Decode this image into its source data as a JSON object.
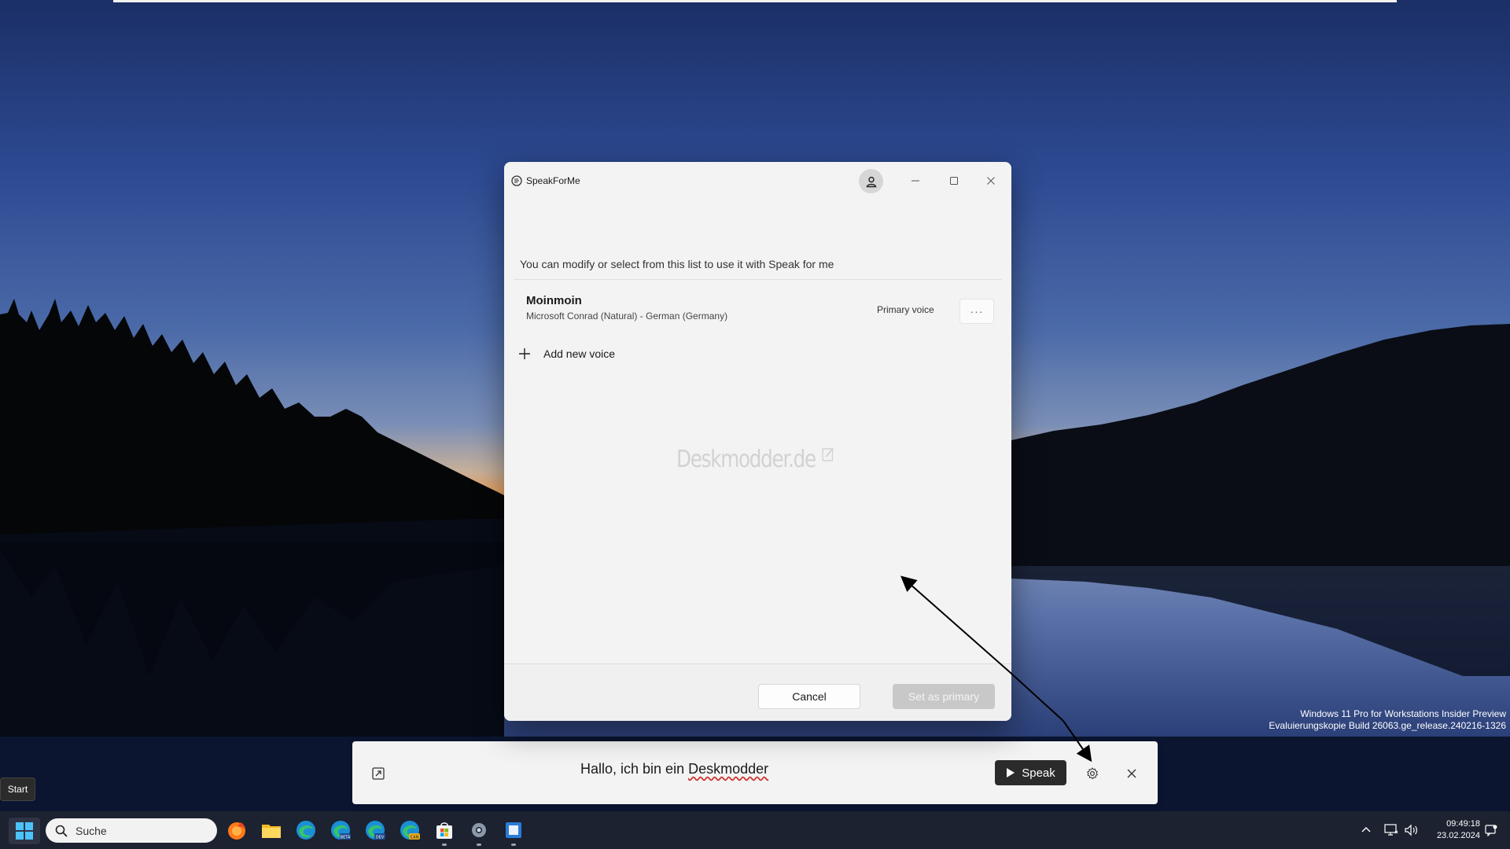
{
  "desktop": {
    "edition_line1": "Windows 11 Pro for Workstations Insider Preview",
    "edition_line2": "Evaluierungskopie Build 26063.ge_release.240216-1326"
  },
  "window": {
    "app_title": "SpeakForMe",
    "intro_text": "You can modify or select from this list to use it with Speak for me",
    "voices": [
      {
        "name": "Moinmoin",
        "description": "Microsoft Conrad (Natural) - German (Germany)",
        "status": "Primary voice",
        "more_label": "···"
      }
    ],
    "add_voice_label": "Add new voice",
    "site_mark": "Deskmodder.de",
    "cancel_label": "Cancel",
    "set_primary_label": "Set as primary"
  },
  "speakbar": {
    "phrase_part1": "Hallo, ich bin ein ",
    "phrase_part2": "Deskmodder",
    "speak_label": "Speak"
  },
  "tooltip": {
    "label": "Start"
  },
  "taskbar": {
    "search_placeholder": "Suche",
    "apps": [
      "firefox-icon",
      "file-explorer-icon",
      "edge-icon",
      "edge-beta-icon",
      "edge-dev-icon",
      "edge-canary-icon",
      "store-icon",
      "settings-icon",
      "notepad-icon"
    ],
    "time": "09:49:18",
    "date": "23.02.2024"
  },
  "colors": {
    "window_bg": "#f3f3f3",
    "taskbar_bg": "#1c2230",
    "speak_button_bg": "#2b2b2b",
    "disabled_button_bg": "#c8c8c8",
    "spell_underline": "#d0312d"
  }
}
